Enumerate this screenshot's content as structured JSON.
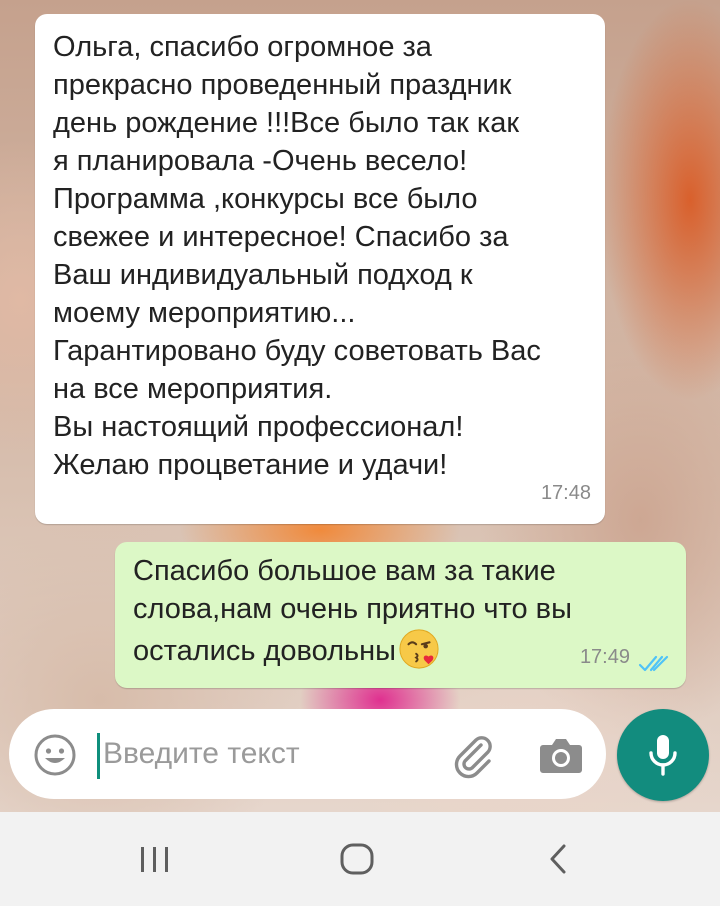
{
  "messages": {
    "incoming": {
      "text": "Ольга, спасибо огромное за\nпрекрасно проведенный праздник\nдень рождение !!!Все было так как\nя планировала -Очень весело!\nПрограмма ,конкурсы все было\nсвежее и интересное! Спасибо за\nВаш индивидуальный подход к\nмоему мероприятию...\nГарантировано буду советовать Вас\nна все мероприятия.\n   Вы настоящий профессионал!\n    Желаю процветание и удачи!",
      "time": "17:48"
    },
    "outgoing": {
      "text": "Спасибо большое вам за такие слова,нам очень приятно что вы остались довольны",
      "emoji": "kissing-face-wink-emoji",
      "time": "17:49",
      "status": "read"
    }
  },
  "composer": {
    "placeholder": "Введите текст",
    "icons": [
      "smiley-icon",
      "paperclip-icon",
      "camera-icon",
      "microphone-icon"
    ]
  },
  "navbar": {
    "icons": [
      "recent-apps-icon",
      "home-icon",
      "back-icon"
    ]
  },
  "colors": {
    "outgoing_bubble": "#dcf8c6",
    "incoming_bubble": "#ffffff",
    "accent": "#128c7e",
    "read_ticks": "#4fc3f7"
  }
}
